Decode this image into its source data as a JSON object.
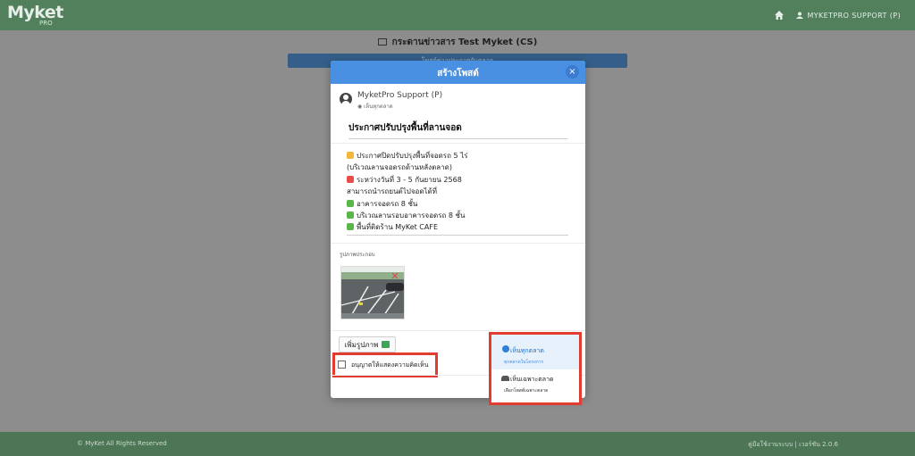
{
  "app": {
    "logo": "Myket",
    "logo_sub": "PRO",
    "user_label": "MYKETPRO SUPPORT (P)"
  },
  "page": {
    "title": "กระดานข่าวสาร Test Myket (CS)",
    "strip_text": "โพสต์ข่าวประกาศกับตลาด"
  },
  "modal": {
    "title": "สร้างโพสต์",
    "close_label": "×",
    "author_name": "MyketPro Support (P)",
    "author_visibility": "เห็นทุกตลาด",
    "post_title": "ประกาศปรับปรุงพื้นที่ลานจอด",
    "post_body_lines": [
      "ประกาศปิดปรับปรุงพื้นที่จอดรถ 5 ไร่",
      "(บริเวณลานจอดรถด้านหลังตลาด)",
      "ระหว่างวันที่ 3 - 5 กันยายน 2568",
      "สามารถนำรถยนต์ไปจอดได้ที่",
      "อาคารจอดรถ 8 ชั้น",
      "บริเวณลานรอบอาคารจอดรถ 8 ชั้น",
      "พื้นที่ติดร้าน MyKet CAFE"
    ],
    "images_label": "รูปภาพประกอบ",
    "add_image_label": "เพิ่มรูปภาพ",
    "allow_comments_label": "อนุญาตให้แสดงความคิดเห็น",
    "allow_comments_checked": false
  },
  "visibility_menu": {
    "options": [
      {
        "label": "เห็นทุกตลาด",
        "sub": "ทุกตลาดในโครงการ",
        "selected": true
      },
      {
        "label": "เห็นเฉพาะตลาด",
        "sub": "เลือกโพสต์เฉพาะตลาด",
        "selected": false
      }
    ]
  },
  "footer": {
    "copyright": "© MyKet All Rights Reserved",
    "right_text": "คู่มือใช้งานระบบ | เวอร์ชัน 2.0.6"
  },
  "colors": {
    "topbar": "#52805c",
    "modal_header": "#4a90e2",
    "highlight": "#e23b2f"
  }
}
